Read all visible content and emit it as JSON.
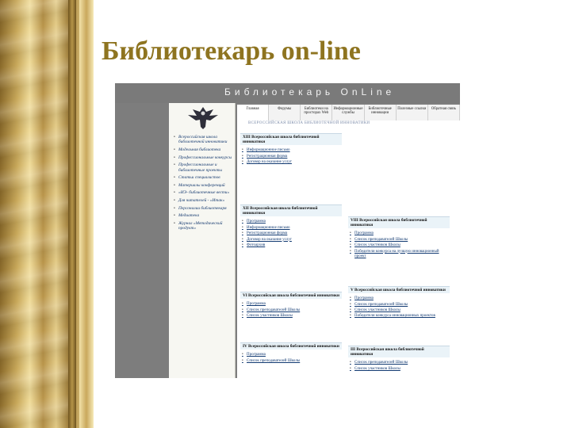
{
  "slide": {
    "title": "Библиотекарь on-line"
  },
  "site": {
    "banner": "Библиотекарь OnLine",
    "content_header": "ВСЕРОССИЙСКАЯ ШКОЛА БИБЛИОТЕЧНОЙ ИННОВАТИКИ",
    "tabs": [
      "Главная",
      "Форумы",
      "Библиотеки на просторах Web",
      "Информационные службы",
      "Библиотечные инновации",
      "Полезные ссылки",
      "Обратная связь"
    ],
    "left_nav": [
      "Всероссийская школа библиотечной инноватики",
      "Модельная библиотека",
      "Профессиональные конкурсы",
      "Профессиональные и библиотечные проекты",
      "Статьи специалистов",
      "Материалы конференций",
      "«ИЭ- библиотечные вести»",
      "Для читателей - «Итак»",
      "Персоналии библиотекаря",
      "Медиатека",
      "Журнал «Методический продукт»"
    ],
    "sections": [
      {
        "title": "XIII Всероссийская школа библиотечной инноватики",
        "items": [
          "Информационное письмо",
          "Регистрационная форма",
          "Договор на оказание услуг"
        ]
      },
      {
        "title": "XII Всероссийская школа библиотечной инноватики",
        "items": [
          "Программа",
          "Информационное письмо",
          "Регистрационная форма",
          "Договор на оказание услуг",
          "Фотоархив"
        ]
      },
      {
        "title": "VIII Всероссийская школа библиотечной инноватики",
        "items": [
          "Программа",
          "Список преподавателей Школы",
          "Список участников Школы",
          "Победители конкурса на лучшую инновационный проект"
        ]
      },
      {
        "title": "VI Всероссийская школа библиотечной инноватики",
        "items": [
          "Программа",
          "Список преподавателей Школы",
          "Список участников Школы"
        ]
      },
      {
        "title": "V Всероссийская школа библиотечной инноватики",
        "items": [
          "Программа",
          "Список преподавателей Школы",
          "Список участников Школы",
          "Победители конкурса инновационных проектов"
        ]
      },
      {
        "title": "IV Всероссийская школа библиотечной инноватики",
        "items": [
          "Программа",
          "Список преподавателей Школы"
        ]
      },
      {
        "title": "III Всероссийская школа библиотечной инноватики",
        "items": [
          "Список преподавателей Школы",
          "Список участников Школы"
        ]
      }
    ]
  },
  "colors": {
    "title_gold": "#8e7420",
    "banner_gray": "#7a7a7a",
    "link_blue": "#123a72"
  },
  "icons": {
    "logo": "eagle-emblem-icon"
  }
}
